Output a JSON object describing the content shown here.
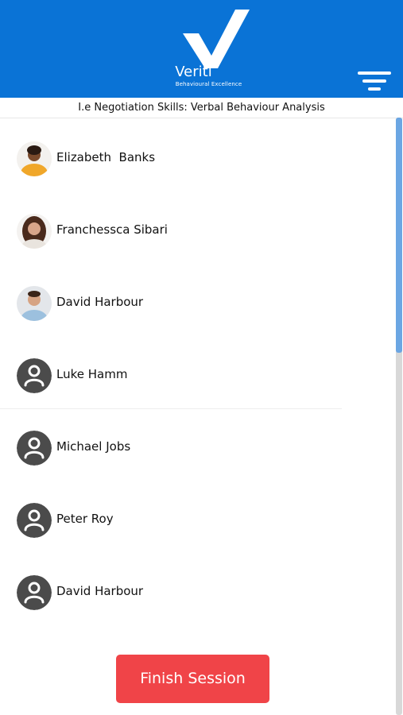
{
  "header": {
    "brand_name": "Verití",
    "brand_tagline": "Behavioural Excellence",
    "bg_color": "#0a73d6"
  },
  "subtitle": "I.e Negotiation Skills: Verbal Behaviour Analysis",
  "participants": [
    {
      "name": "Elizabeth  Banks",
      "avatar": "photo"
    },
    {
      "name": "Franchessca Sibari",
      "avatar": "photo"
    },
    {
      "name": "David Harbour",
      "avatar": "photo"
    },
    {
      "name": "Luke Hamm",
      "avatar": "default-user-icon"
    },
    {
      "name": "Michael Jobs",
      "avatar": "default-user-icon"
    },
    {
      "name": "Peter Roy",
      "avatar": "default-user-icon"
    },
    {
      "name": "David Harbour",
      "avatar": "default-user-icon"
    }
  ],
  "finish_button": {
    "label": "Finish Session",
    "color": "#f04448"
  }
}
